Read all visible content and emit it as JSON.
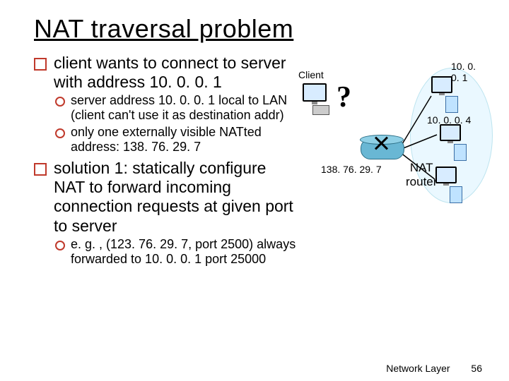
{
  "title": "NAT traversal problem",
  "bullets": {
    "b1": "client wants to connect to server with address 10. 0. 0. 1",
    "b1a": "server address 10. 0. 0. 1 local to LAN (client can't use it as destination addr)",
    "b1b": "only one externally visible NATted address: 138. 76. 29. 7",
    "b2": "solution 1: statically configure NAT to forward incoming connection requests at given port to server",
    "b2a": "e. g. , (123. 76. 29. 7, port 2500) always forwarded to 10. 0. 0. 1 port 25000"
  },
  "diagram": {
    "client_label": "Client",
    "question_mark": "?",
    "ext_ip": "138. 76. 29. 7",
    "nat_label": "NAT\nrouter",
    "host1_ip": "10. 0. 0. 1",
    "host2_ip": "10. 0. 0. 4"
  },
  "footer": {
    "section": "Network Layer",
    "page": "56"
  }
}
